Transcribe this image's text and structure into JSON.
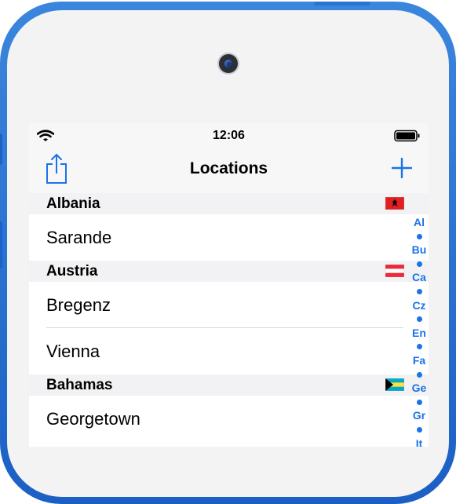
{
  "status": {
    "time": "12:06"
  },
  "nav": {
    "title": "Locations"
  },
  "sections": [
    {
      "title": "Albania",
      "rows": [
        "Sarande"
      ]
    },
    {
      "title": "Austria",
      "rows": [
        "Bregenz",
        "Vienna"
      ]
    },
    {
      "title": "Bahamas",
      "rows": [
        "Georgetown"
      ]
    }
  ],
  "index": {
    "letters": [
      "Al",
      "Bu",
      "Ca",
      "Cz",
      "En",
      "Fa",
      "Ge",
      "Gr",
      "It"
    ]
  },
  "colors": {
    "accent": "#1a73e8",
    "device": "#2a6fd6"
  }
}
